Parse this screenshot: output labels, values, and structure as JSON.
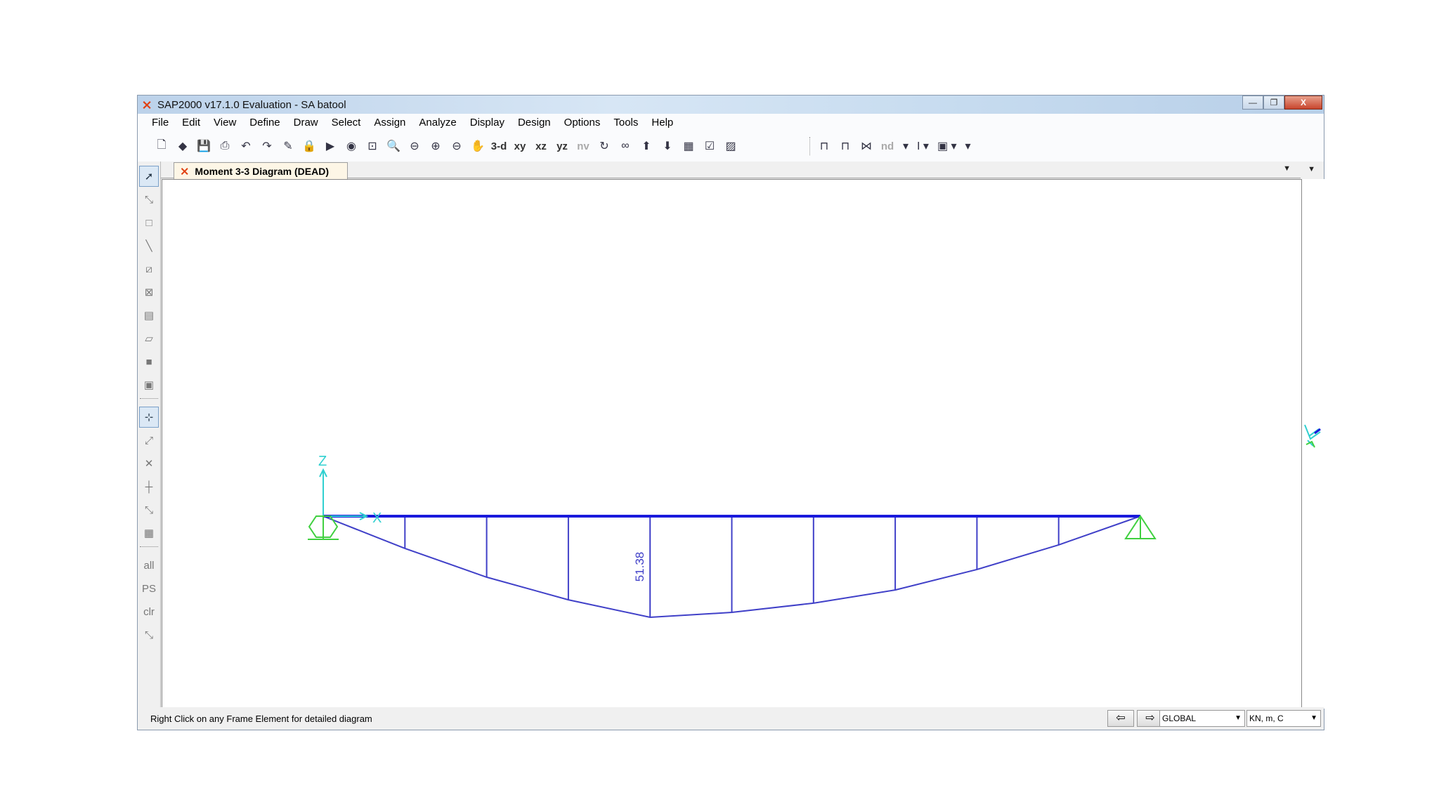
{
  "window": {
    "title": "SAP2000 v17.1.0 Evaluation  - SA batool",
    "controls": [
      "—",
      "❐",
      "X"
    ]
  },
  "menu": [
    "File",
    "Edit",
    "View",
    "Define",
    "Draw",
    "Select",
    "Assign",
    "Analyze",
    "Display",
    "Design",
    "Options",
    "Tools",
    "Help"
  ],
  "toolbar": {
    "left": [
      {
        "name": "new-icon",
        "g": "🗋"
      },
      {
        "name": "open-icon",
        "g": "◆"
      },
      {
        "name": "save-icon",
        "g": "💾"
      },
      {
        "name": "print-icon",
        "g": "⎙"
      },
      {
        "name": "undo-icon",
        "g": "↶"
      },
      {
        "name": "redo-icon",
        "g": "↷"
      },
      {
        "name": "pencil-icon",
        "g": "✎"
      },
      {
        "name": "lock-icon",
        "g": "🔒"
      },
      {
        "name": "run-icon",
        "g": "▶"
      },
      {
        "name": "run-animation-icon",
        "g": "◉"
      },
      {
        "name": "zoom-window-icon",
        "g": "⊡"
      },
      {
        "name": "zoom-restore-icon",
        "g": "🔍"
      },
      {
        "name": "zoom-previous-icon",
        "g": "⊖"
      },
      {
        "name": "zoom-in-icon",
        "g": "⊕"
      },
      {
        "name": "zoom-out-icon",
        "g": "⊖"
      },
      {
        "name": "pan-icon",
        "g": "✋"
      }
    ],
    "views": [
      "3-d",
      "xy",
      "xz",
      "yz",
      "nv"
    ],
    "right": [
      {
        "name": "rotate-icon",
        "g": "↻"
      },
      {
        "name": "perspective-icon",
        "g": "∞"
      },
      {
        "name": "move-up-icon",
        "g": "⬆"
      },
      {
        "name": "move-down-icon",
        "g": "⬇"
      },
      {
        "name": "object-shrink-icon",
        "g": "▦"
      },
      {
        "name": "check-icon",
        "g": "☑"
      },
      {
        "name": "assign-display-icon",
        "g": "▨"
      }
    ],
    "group2": [
      {
        "name": "frame-icon",
        "g": "⊓"
      },
      {
        "name": "portal-frame-icon",
        "g": "⊓"
      },
      {
        "name": "deformed-shape-icon",
        "g": "⋈"
      }
    ],
    "nd": "nd"
  },
  "tab": {
    "label": "Moment 3-3 Diagram (DEAD)"
  },
  "left_toolbar": [
    "pointer-icon",
    "reshaper-icon",
    "draw-joint-icon",
    "draw-frame-icon",
    "quick-draw-frame-icon",
    "quick-brace-icon",
    "quick-secondary-beam-icon",
    "draw-poly-area-icon",
    "draw-rect-area-icon",
    "quick-draw-area-icon",
    "|",
    "snap-joints-icon",
    "snap-ends-icon",
    "snap-intersections-icon",
    "snap-perpendicular-icon",
    "snap-lines-icon",
    "snap-grid-icon",
    "|",
    "select-all-icon",
    "select-previous-icon",
    "clear-selection-icon",
    "intersecting-line-select-icon"
  ],
  "left_toolbar_glyphs": [
    "➚",
    "⤡",
    "□",
    "╲",
    "⧄",
    "⊠",
    "▤",
    "▱",
    "■",
    "▣",
    "|",
    "⊹",
    "⤢",
    "✕",
    "┼",
    "⤡",
    "▦",
    "|",
    "all",
    "PS",
    "clr",
    "⤡"
  ],
  "diagram": {
    "axis_z": "Z",
    "axis_x": "X",
    "max_label": "51.38",
    "stations": [
      0,
      0.1,
      0.2,
      0.3,
      0.4,
      0.5,
      0.6,
      0.7,
      0.8,
      0.9,
      1.0
    ],
    "moments": [
      0,
      16.4,
      31.0,
      42.5,
      51.38,
      48.9,
      44.2,
      37.5,
      27.1,
      14.6,
      0
    ],
    "colors": {
      "beam": "#1a1adc",
      "diagram": "#4040c8",
      "support": "#40d040",
      "axes": "#30d0d0"
    }
  },
  "status": {
    "text": "Right Click on any Frame Element for detailed diagram",
    "coord_system": "GLOBAL",
    "units": "KN, m, C"
  }
}
